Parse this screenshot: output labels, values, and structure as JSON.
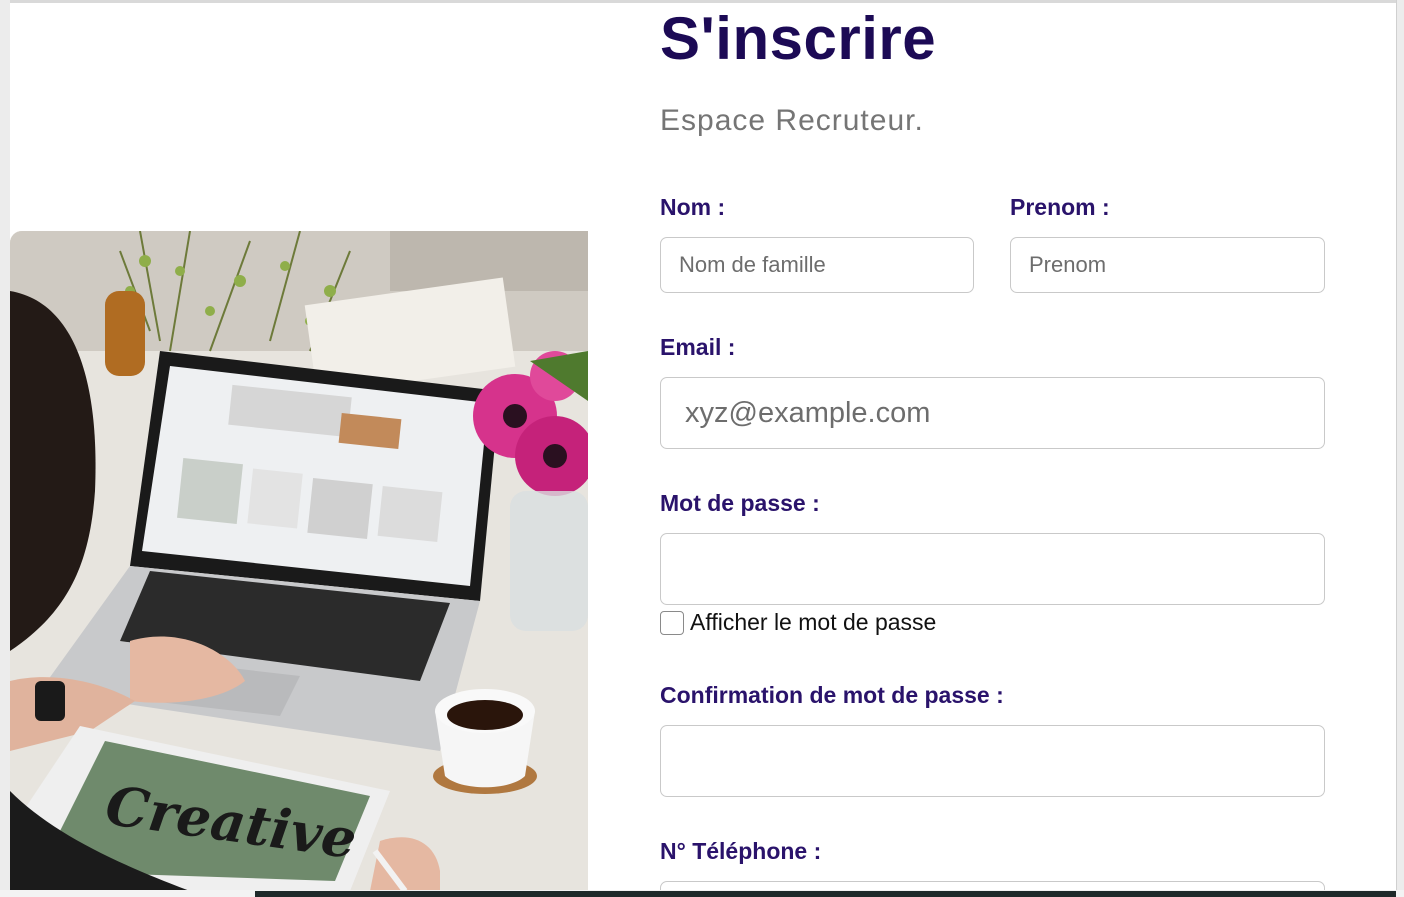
{
  "form": {
    "title": "S'inscrire",
    "subtitle": "Espace Recruteur.",
    "nom": {
      "label": "Nom :",
      "placeholder": "Nom de famille"
    },
    "prenom": {
      "label": "Prenom :",
      "placeholder": "Prenom"
    },
    "email": {
      "label": "Email :",
      "placeholder": "xyz@example.com"
    },
    "password": {
      "label": "Mot de passe :",
      "placeholder": ""
    },
    "show_password": {
      "label": "Afficher le mot de passe",
      "checked": false
    },
    "confirm_password": {
      "label": "Confirmation de mot de passe :",
      "placeholder": ""
    },
    "phone": {
      "label": "N° Téléphone :"
    }
  },
  "illustration": {
    "tablet_text": "Creative"
  },
  "colors": {
    "title": "#1c0a55",
    "label": "#2a136b",
    "subtitle": "#757575"
  }
}
